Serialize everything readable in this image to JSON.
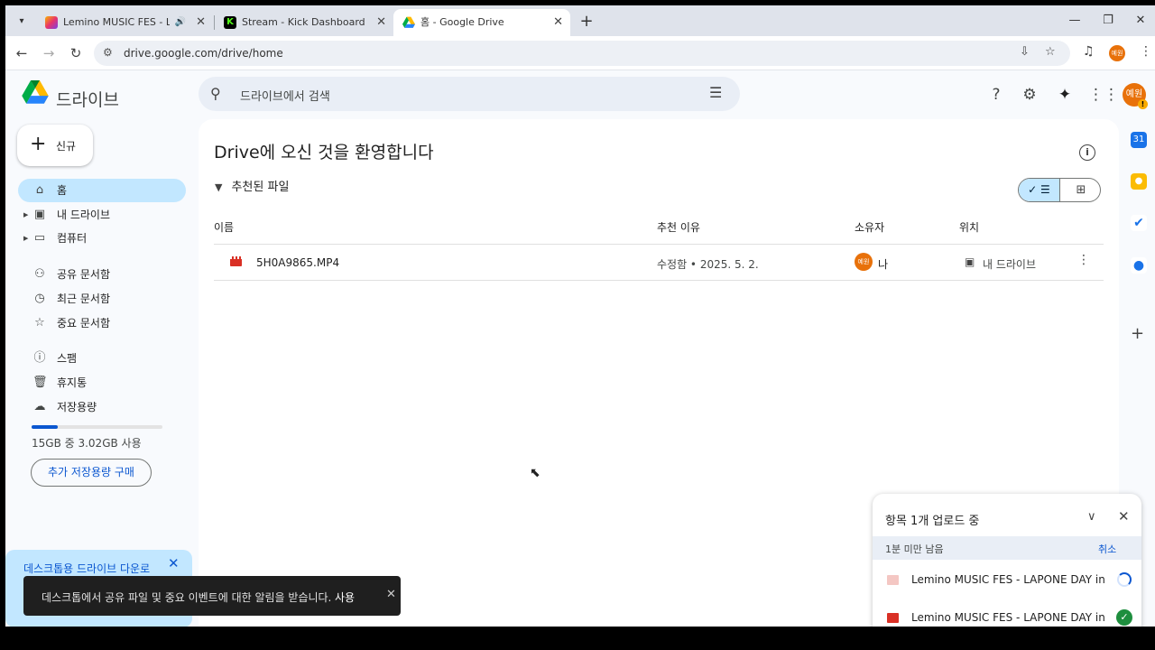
{
  "browser": {
    "tabs": [
      {
        "title": "Lemino MUSIC FES - LAPONE",
        "active": false,
        "favicon_color": "#e8336b"
      },
      {
        "title": "Stream - Kick Dashboard",
        "active": false,
        "favicon_color": "#53fc18"
      },
      {
        "title": "홈 - Google Drive",
        "active": true,
        "favicon_color": "#1a73e8"
      }
    ],
    "url": "drive.google.com/drive/home",
    "profile_initials": "예원"
  },
  "drive": {
    "app_name": "드라이브",
    "search_placeholder": "드라이브에서 검색",
    "avatar_initials": "예원",
    "new_button": "신규",
    "nav": [
      {
        "label": "홈",
        "icon": "home-icon",
        "active": true
      },
      {
        "label": "내 드라이브",
        "icon": "my-drive-icon",
        "caret": true
      },
      {
        "label": "컴퓨터",
        "icon": "computers-icon",
        "caret": true
      },
      {
        "label": "공유 문서함",
        "icon": "shared-icon"
      },
      {
        "label": "최근 문서함",
        "icon": "recent-icon"
      },
      {
        "label": "중요 문서함",
        "icon": "star-icon"
      },
      {
        "label": "스팸",
        "icon": "spam-icon"
      },
      {
        "label": "휴지통",
        "icon": "trash-icon"
      },
      {
        "label": "저장용량",
        "icon": "cloud-icon"
      }
    ],
    "storage": {
      "text": "15GB 중 3.02GB 사용",
      "used_fraction": 0.2
    },
    "buy_storage": "추가 저장용량 구매",
    "desktop_banner": "데스크톱용 드라이브 다운로"
  },
  "main": {
    "welcome": "Drive에 오신 것을 환영합니다",
    "section_title": "추천된 파일",
    "columns": {
      "name": "이름",
      "reason": "추천 이유",
      "owner": "소유자",
      "location": "위치"
    },
    "files": [
      {
        "name": "5H0A9865.MP4",
        "reason": "수정함 • 2025. 5. 2.",
        "owner": "나",
        "owner_initials": "예원",
        "location": "내 드라이브"
      }
    ]
  },
  "toast": {
    "message": "데스크톱에서 공유 파일 및 중요 이벤트에 대한 알림을 받습니다.",
    "action": "사용"
  },
  "upload": {
    "title": "항목 1개 업로드 중",
    "remaining": "1분 미만 남음",
    "cancel": "취소",
    "items": [
      {
        "name": "Lemino MUSIC FES - LAPONE DAY in E...",
        "status": "uploading"
      },
      {
        "name": "Lemino MUSIC FES - LAPONE DAY in E...",
        "status": "done"
      }
    ]
  }
}
